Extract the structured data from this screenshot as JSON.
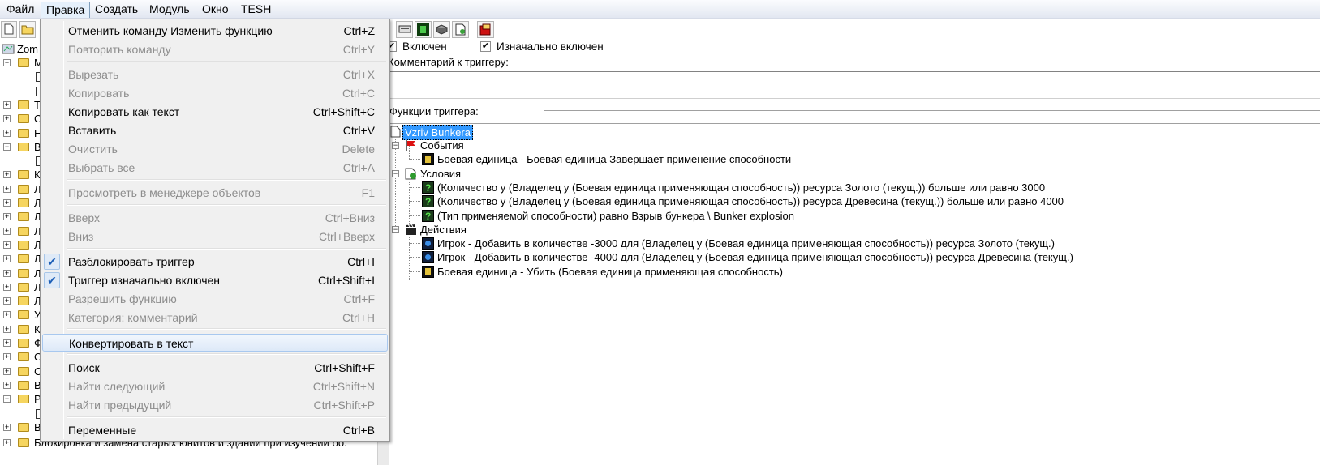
{
  "menubar": {
    "items": [
      "Файл",
      "Правка",
      "Создать",
      "Модуль",
      "Окно",
      "TESH"
    ],
    "active": "Правка"
  },
  "icons": {
    "toolbar_left": [
      "new-file-icon",
      "open-folder-icon"
    ],
    "toolbar_right": [
      "keyboard-icon",
      "green-unit-icon",
      "disk-icon",
      "document-icon",
      "red-test-icon"
    ],
    "folder": "folder-icon",
    "unit": "unit-icon",
    "condition": "condition-icon",
    "player": "player-icon",
    "events": "red-flag-icon",
    "conditions_group": "conditions-icon",
    "actions": "clapperboard-icon"
  },
  "colors": {
    "selection": "#3399ff",
    "menu_bg": "#f0f0f0",
    "disabled_text": "#8d8d8d",
    "check_blue": "#1d5fb7"
  },
  "left_tree": {
    "root_label": "Zom",
    "rows": [
      "M",
      "",
      "",
      "T",
      "С",
      "Н",
      "В",
      "",
      "К",
      "Л",
      "Л",
      "Л",
      "Л",
      "Л",
      "Л",
      "Л",
      "Л",
      "Л",
      "У",
      "К",
      "Ф",
      "С",
      "С",
      "В",
      "Р",
      "",
      "В"
    ],
    "bottom_label": "Блокировка и замена старых юнитов и зданий при изучении бо."
  },
  "trigger_panel": {
    "enabled_label": "Включен",
    "enabled": true,
    "initially_on_label": "Изначально включен",
    "initially_on": true,
    "comment_label": "Комментарий к триггеру:",
    "comment_value": "",
    "functions_label": "Функции триггера:"
  },
  "trigger_tree": {
    "name": "Vzriv Bunkera",
    "events_label": "События",
    "events": [
      "Боевая единица - Боевая единица Завершает применение способности"
    ],
    "conditions_label": "Условия",
    "conditions": [
      "(Количество у (Владелец у (Боевая единица применяющая способность)) ресурса Золото (текущ.)) больше или равно 3000",
      "(Количество у (Владелец у (Боевая единица применяющая способность)) ресурса Древесина (текущ.)) больше или равно 4000",
      "(Тип применяемой способности) равно Взрыв бункера \\ Bunker explosion"
    ],
    "actions_label": "Действия",
    "actions": [
      "Игрок - Добавить в количестве -3000 для (Владелец у (Боевая единица применяющая способность)) ресурса Золото (текущ.)",
      "Игрок - Добавить в количестве -4000 для (Владелец у (Боевая единица применяющая способность)) ресурса Древесина (текущ.)",
      "Боевая единица - Убить (Боевая единица применяющая способность)"
    ]
  },
  "edit_menu": {
    "items": [
      {
        "label": "Отменить команду Изменить функцию",
        "shortcut": "Ctrl+Z",
        "enabled": true
      },
      {
        "label": "Повторить команду",
        "shortcut": "Ctrl+Y",
        "enabled": false
      },
      {
        "label": "Вырезать",
        "shortcut": "Ctrl+X",
        "enabled": false
      },
      {
        "label": "Копировать",
        "shortcut": "Ctrl+C",
        "enabled": false
      },
      {
        "label": "Копировать как текст",
        "shortcut": "Ctrl+Shift+C",
        "enabled": true
      },
      {
        "label": "Вставить",
        "shortcut": "Ctrl+V",
        "enabled": true
      },
      {
        "label": "Очистить",
        "shortcut": "Delete",
        "enabled": false
      },
      {
        "label": "Выбрать все",
        "shortcut": "Ctrl+A",
        "enabled": false
      },
      {
        "label": "Просмотреть в менеджере объектов",
        "shortcut": "F1",
        "enabled": false
      },
      {
        "label": "Вверх",
        "shortcut": "Ctrl+Вниз",
        "enabled": false
      },
      {
        "label": "Вниз",
        "shortcut": "Ctrl+Вверх",
        "enabled": false
      },
      {
        "label": "Разблокировать триггер",
        "shortcut": "Ctrl+I",
        "enabled": true,
        "checked": true
      },
      {
        "label": "Триггер изначально включен",
        "shortcut": "Ctrl+Shift+I",
        "enabled": true,
        "checked": true
      },
      {
        "label": "Разрешить функцию",
        "shortcut": "Ctrl+F",
        "enabled": false
      },
      {
        "label": "Категория: комментарий",
        "shortcut": "Ctrl+H",
        "enabled": false
      },
      {
        "label": "Конвертировать в текст",
        "shortcut": "",
        "enabled": true,
        "highlighted": true
      },
      {
        "label": "Поиск",
        "shortcut": "Ctrl+Shift+F",
        "enabled": true
      },
      {
        "label": "Найти следующий",
        "shortcut": "Ctrl+Shift+N",
        "enabled": false
      },
      {
        "label": "Найти предыдущий",
        "shortcut": "Ctrl+Shift+P",
        "enabled": false
      },
      {
        "label": "Переменные",
        "shortcut": "Ctrl+B",
        "enabled": true
      }
    ]
  }
}
